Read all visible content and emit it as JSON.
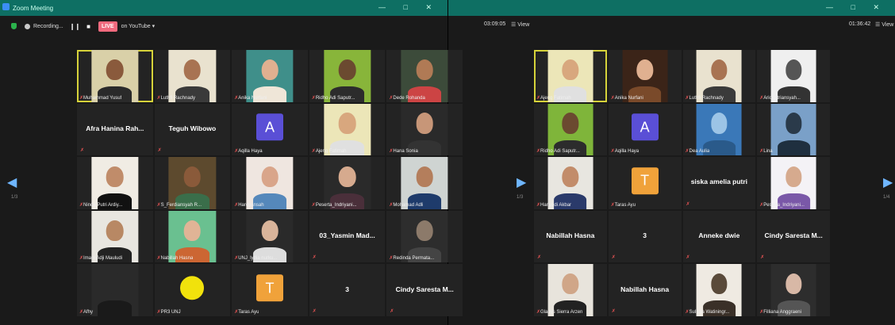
{
  "left_window": {
    "title": "Zoom Meeting",
    "recording_label": "Recording...",
    "live_badge": "LIVE",
    "youtube_label": "on YouTube ▾",
    "timer": "03:09:05",
    "view_label": "View",
    "page_indicator": "1/3",
    "tiles": [
      {
        "kind": "video",
        "name": "Muhammad Yusuf",
        "bg": "#d9d0a8",
        "skin": "#8a5a3c",
        "shirt": "#2a2a2a",
        "speaker": true
      },
      {
        "kind": "video",
        "name": "Luthfi Rachnady",
        "bg": "#e9e2cf",
        "skin": "#a87352",
        "shirt": "#3a3a3a"
      },
      {
        "kind": "video",
        "name": "Anika Nurfani",
        "bg": "#3f8f8a",
        "skin": "#e0b090",
        "shirt": "#efe6d8"
      },
      {
        "kind": "video",
        "name": "Ridho Adi Saputr...",
        "bg": "#88b53a",
        "skin": "#6b4a30",
        "shirt": "#2c2c2c"
      },
      {
        "kind": "video",
        "name": "Dede Rohanda",
        "bg": "#3c4b3a",
        "skin": "#b07a55",
        "shirt": "#c44"
      },
      {
        "kind": "name",
        "name": "Afra Hanina Rah..."
      },
      {
        "kind": "name",
        "name": "Teguh Wibowo"
      },
      {
        "kind": "avatar",
        "name": "Aqilla Haya",
        "letter": "A",
        "color": "#5a4fd6"
      },
      {
        "kind": "video",
        "name": "Ajeng Fatimah",
        "bg": "#ece6b8",
        "skin": "#d8a77e",
        "shirt": "#e0e0e0"
      },
      {
        "kind": "video",
        "name": "Hana Sonia",
        "bg": "#2a2a2a",
        "skin": "#c79678",
        "shirt": "#333"
      },
      {
        "kind": "video",
        "name": "Ninda Putri Ardiy...",
        "bg": "#f0ece4",
        "skin": "#c08c6a",
        "shirt": "#111"
      },
      {
        "kind": "video",
        "name": "S_Ferdiansyah R...",
        "bg": "#5d4a2e",
        "skin": "#8a5a3a",
        "shirt": "#3a6e4a"
      },
      {
        "kind": "video",
        "name": "Hardyansah",
        "bg": "#efe6e0",
        "skin": "#d9a58a",
        "shirt": "#58b"
      },
      {
        "kind": "video",
        "name": "Peserta_Indriyani...",
        "bg": "#2a2a2a",
        "skin": "#d6aa8e",
        "shirt": "#4a2f3a"
      },
      {
        "kind": "video",
        "name": "Mohamad Adli",
        "bg": "#cfd4d2",
        "skin": "#b47e5c",
        "shirt": "#1e3b6b"
      },
      {
        "kind": "video",
        "name": "Imam Adji Mauludi",
        "bg": "#e8e6e0",
        "skin": "#b88864",
        "shirt": "#222"
      },
      {
        "kind": "video",
        "name": "Nabillah Hasna",
        "bg": "#6ac090",
        "skin": "#e0b496",
        "shirt": "#c63"
      },
      {
        "kind": "video",
        "name": "UNJ_lydia nurku...",
        "bg": "#2a2a2a",
        "skin": "#d9b49a",
        "shirt": "#ddd"
      },
      {
        "kind": "name",
        "name": "03_Yasmin Mad..."
      },
      {
        "kind": "video",
        "name": "Redinda Permata...",
        "bg": "#2d2d2d",
        "skin": "#8c7a6a",
        "shirt": "#444"
      },
      {
        "kind": "video",
        "name": "Afhy",
        "bg": "#2a2a2a",
        "skin": "#2a2a2a",
        "shirt": "#1a1a1a"
      },
      {
        "kind": "logo",
        "name": "PR3 UNJ"
      },
      {
        "kind": "avatar",
        "name": "Taras Ayu",
        "letter": "T",
        "color": "#f0a23a"
      },
      {
        "kind": "name",
        "name": "3"
      },
      {
        "kind": "name",
        "name": "Cindy Saresta M..."
      }
    ]
  },
  "right_window": {
    "timer": "01:36:42",
    "view_label": "View",
    "page_indicator_left": "1/3",
    "page_indicator_right": "1/4",
    "tiles": [
      {
        "kind": "video",
        "name": "Ajeng Fatimah",
        "bg": "#ece6b8",
        "skin": "#d8a77e",
        "shirt": "#e0e0e0",
        "speaker": true
      },
      {
        "kind": "video",
        "name": "Anika Nurfani",
        "bg": "#3b2418",
        "skin": "#e0b090",
        "shirt": "#7a4a2a"
      },
      {
        "kind": "video",
        "name": "Luthfi Rachnady",
        "bg": "#e9e2cf",
        "skin": "#a87352",
        "shirt": "#3a3a3a"
      },
      {
        "kind": "video",
        "name": "Ario Fitriansyah...",
        "bg": "#efefef",
        "skin": "#555",
        "shirt": "#333"
      },
      {
        "kind": "video",
        "name": "Ridho Adi Saputr...",
        "bg": "#7fb53a",
        "skin": "#6b4a30",
        "shirt": "#2c2c2c"
      },
      {
        "kind": "avatar",
        "name": "Aqilla Haya",
        "letter": "A",
        "color": "#5a4fd6"
      },
      {
        "kind": "video",
        "name": "Dea Aulia",
        "bg": "#3a78b8",
        "skin": "#9cc4e6",
        "shirt": "#2a5a8a"
      },
      {
        "kind": "video",
        "name": "Lina",
        "bg": "#7aa0c8",
        "skin": "#2a3a4a",
        "shirt": "#1f2f3f"
      },
      {
        "kind": "video",
        "name": "Hariyadi Akbar",
        "bg": "#e8e6e0",
        "skin": "#c28c6a",
        "shirt": "#2a3a6a"
      },
      {
        "kind": "avatar",
        "name": "Taras Ayu",
        "letter": "T",
        "color": "#f0a23a"
      },
      {
        "kind": "name",
        "name": "siska amelia putri"
      },
      {
        "kind": "video",
        "name": "Peserta_Indriyani...",
        "bg": "#f4f2f6",
        "skin": "#d6aa8e",
        "shirt": "#7a58a8"
      },
      {
        "kind": "name",
        "name": "Nabillah Hasna"
      },
      {
        "kind": "name",
        "name": "3"
      },
      {
        "kind": "name",
        "name": "Anneke dwie"
      },
      {
        "kind": "name",
        "name": "Cindy Saresta M..."
      },
      {
        "kind": "video",
        "name": "Gladys Sierra Arzen",
        "bg": "#e8e4dc",
        "skin": "#d0a688",
        "shirt": "#222"
      },
      {
        "kind": "name",
        "name": "Nabillah Hasna"
      },
      {
        "kind": "video",
        "name": "Sulistia Watiningr...",
        "bg": "#efeae2",
        "skin": "#5a4a3a",
        "shirt": "#3a3028"
      },
      {
        "kind": "video",
        "name": "Filliana Anggraeni",
        "bg": "#2d2d2d",
        "skin": "#d8b8a6",
        "shirt": "#555"
      }
    ]
  }
}
